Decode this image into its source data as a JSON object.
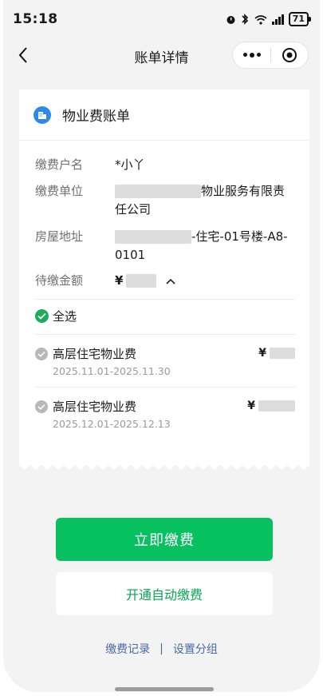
{
  "status_bar": {
    "time": "15:18",
    "battery": "71"
  },
  "nav": {
    "title": "账单详情"
  },
  "card": {
    "title": "物业费账单",
    "fields": [
      {
        "label": "缴费户名",
        "value": "*小丫"
      },
      {
        "label": "缴费单位",
        "value": "物业服务有限责",
        "value_line2": "任公司"
      },
      {
        "label": "房屋地址",
        "value": "-住宅-01号楼-A8-",
        "value_line2": "0101"
      },
      {
        "label": "待缴金额",
        "currency": "¥"
      }
    ],
    "select_all": "全选",
    "items": [
      {
        "name": "高层住宅物业费",
        "period": "2025.11.01-2025.11.30",
        "currency": "¥"
      },
      {
        "name": "高层住宅物业费",
        "period": "2025.12.01-2025.12.13",
        "currency": "¥"
      }
    ]
  },
  "actions": {
    "pay_now": "立即缴费",
    "auto_pay": "开通自动缴费"
  },
  "footer_links": {
    "records": "缴费记录",
    "separator": "|",
    "group": "设置分组"
  },
  "colors": {
    "primary_green": "#07c160",
    "link_blue": "#4a6aa8",
    "icon_blue": "#2e8ae6"
  }
}
